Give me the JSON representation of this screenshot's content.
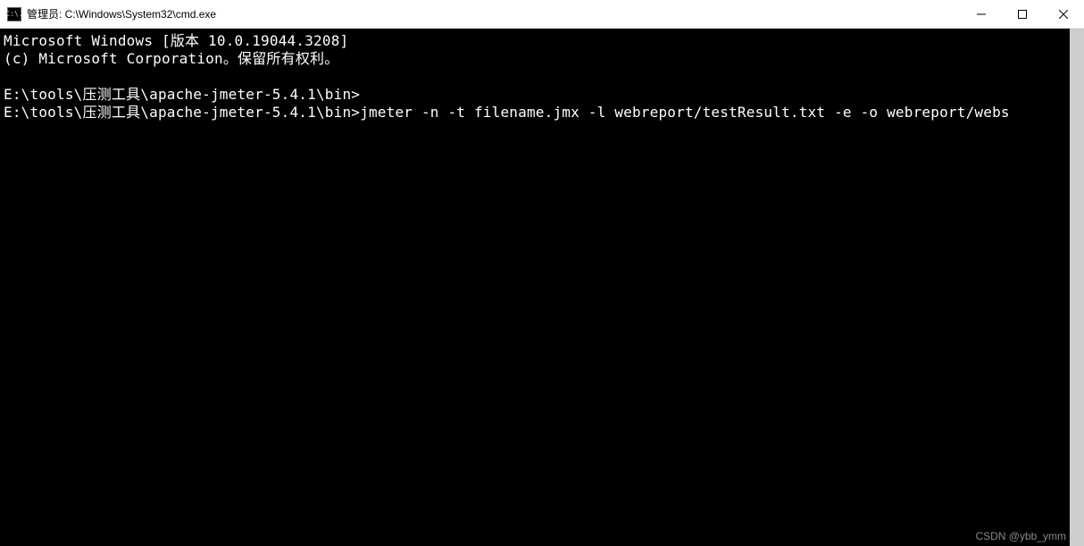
{
  "window": {
    "title": "管理员: C:\\Windows\\System32\\cmd.exe",
    "icon_label": "C:\\."
  },
  "terminal": {
    "line1": "Microsoft Windows [版本 10.0.19044.3208]",
    "line2": "(c) Microsoft Corporation。保留所有权利。",
    "blank1": "",
    "line3": "E:\\tools\\压测工具\\apache-jmeter-5.4.1\\bin>",
    "line4_prompt": "E:\\tools\\压测工具\\apache-jmeter-5.4.1\\bin>",
    "line4_cmd": "jmeter -n -t filename.jmx -l webreport/testResult.txt -e -o webreport/webs"
  },
  "watermark": "CSDN @ybb_ymm"
}
